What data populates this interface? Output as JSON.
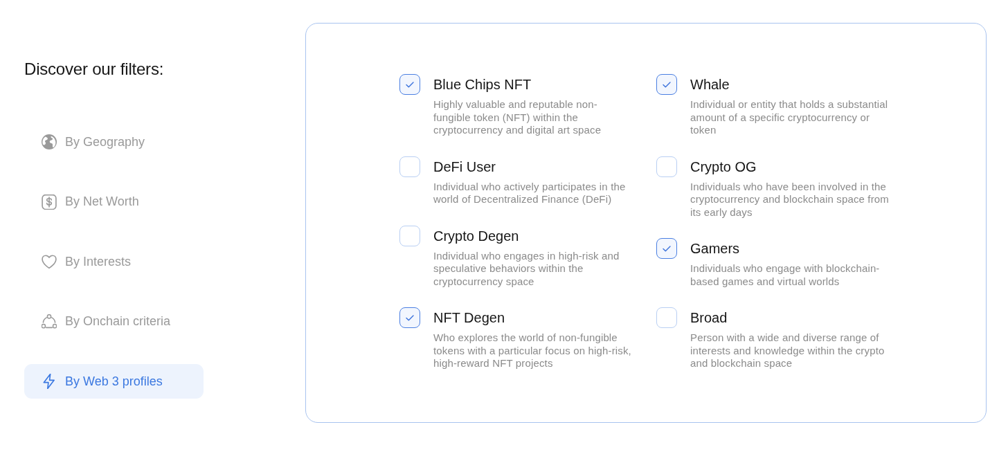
{
  "heading": "Discover our filters:",
  "filters": [
    {
      "label": "By Geography",
      "selected": false
    },
    {
      "label": "By Net Worth",
      "selected": false
    },
    {
      "label": "By Interests",
      "selected": false
    },
    {
      "label": "By Onchain criteria",
      "selected": false
    },
    {
      "label": "By Web 3 profiles",
      "selected": true
    }
  ],
  "profile_columns": [
    {
      "items": [
        {
          "title": "Blue Chips NFT",
          "description": "Highly valuable and reputable non-fungible token (NFT) within the cryptocurrency and digital art space",
          "checked": true
        },
        {
          "title": "DeFi User",
          "description": "Individual who actively participates in the world of Decentralized Finance (DeFi)",
          "checked": false
        },
        {
          "title": "Crypto Degen",
          "description": "Individual who engages in high-risk and speculative behaviors within the cryptocurrency space",
          "checked": false
        },
        {
          "title": "NFT Degen",
          "description": "Who explores the world of non-fungible tokens with a particular focus on high-risk, high-reward NFT projects",
          "checked": true
        }
      ]
    },
    {
      "items": [
        {
          "title": "Whale",
          "description": "Individual or entity that holds a substantial amount of a specific cryptocurrency or token",
          "checked": true
        },
        {
          "title": "Crypto OG",
          "description": "Individuals who have been involved in the cryptocurrency and blockchain space from its early days",
          "checked": false
        },
        {
          "title": "Gamers",
          "description": "Individuals who engage with blockchain-based games and virtual worlds",
          "checked": true
        },
        {
          "title": "Broad",
          "description": "Person with a wide and diverse range of interests and knowledge within the crypto and blockchain space",
          "checked": false
        }
      ]
    }
  ]
}
